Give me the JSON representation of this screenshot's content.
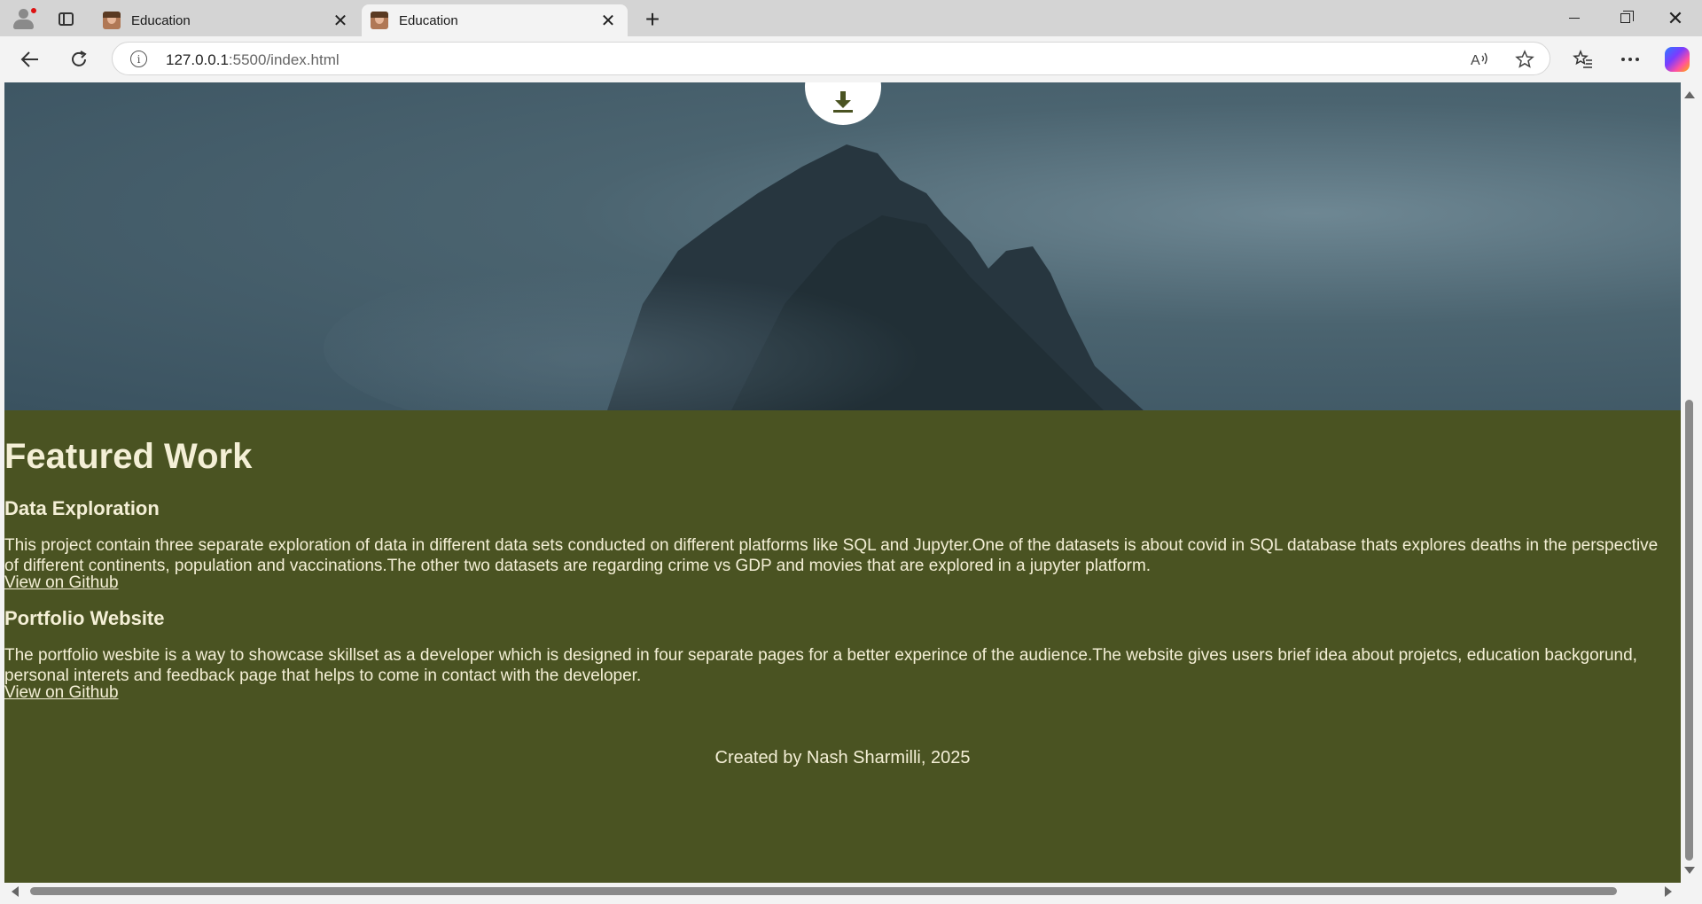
{
  "browser": {
    "tabs": [
      {
        "title": "Education",
        "active": false
      },
      {
        "title": "Education",
        "active": true
      }
    ],
    "new_tab_icon": "plus-icon",
    "url_host": "127.0.0.1",
    "url_path": ":5500/index.html"
  },
  "hero": {
    "download_icon": "download-icon"
  },
  "featured": {
    "heading": "Featured Work",
    "projects": [
      {
        "title": "Data Exploration",
        "description": "This project contain three separate exploration of data in different data sets conducted on different platforms like SQL and Jupyter.One of the datasets is about covid in SQL database thats explores deaths in the perspective of different continents, population and vaccinations.The other two datasets are regarding crime vs GDP and movies that are explored in a jupyter platform.",
        "link": "View on Github"
      },
      {
        "title": "Portfolio Website",
        "description": "The portfolio wesbite is a way to showcase skillset as a developer which is designed in four separate pages for a better experince of the audience.The website gives users brief idea about projetcs, education backgorund, personal interets and feedback page that helps to come in contact with the developer.",
        "link": "View on Github"
      }
    ]
  },
  "footer": {
    "text": "Created by Nash Sharmilli, 2025"
  },
  "colors": {
    "page_bg": "#4a5322",
    "text": "#f4efd6",
    "hero_sky": "#4b6470"
  }
}
